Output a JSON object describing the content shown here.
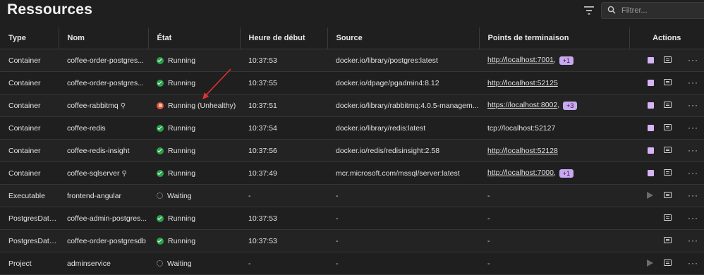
{
  "page": {
    "title": "Ressources"
  },
  "search": {
    "placeholder": "Filtrer..."
  },
  "columns": [
    "Type",
    "Nom",
    "État",
    "Heure de début",
    "Source",
    "Points de terminaison",
    "Actions"
  ],
  "rows": [
    {
      "type": "Container",
      "name": "coffee-order-postgres...",
      "pinned": false,
      "state": "Running",
      "state_kind": "ok",
      "start": "10:37:53",
      "source": "docker.io/library/postgres:latest",
      "endpoint": "http://localhost:7001",
      "endpoint_link": true,
      "endpoint_suffix": ",",
      "badge": "+1",
      "can_stop": true
    },
    {
      "type": "Container",
      "name": "coffee-order-postgres...",
      "pinned": false,
      "state": "Running",
      "state_kind": "ok",
      "start": "10:37:55",
      "source": "docker.io/dpage/pgadmin4:8.12",
      "endpoint": "http://localhost:52125",
      "endpoint_link": true,
      "endpoint_suffix": "",
      "badge": "",
      "can_stop": true
    },
    {
      "type": "Container",
      "name": "coffee-rabbitmq",
      "pinned": true,
      "state": "Running (Unhealthy)",
      "state_kind": "warn",
      "start": "10:37:51",
      "source": "docker.io/library/rabbitmq:4.0.5-managem...",
      "endpoint": "https://localhost:8002",
      "endpoint_link": true,
      "endpoint_suffix": ",",
      "badge": "+3",
      "can_stop": true
    },
    {
      "type": "Container",
      "name": "coffee-redis",
      "pinned": false,
      "state": "Running",
      "state_kind": "ok",
      "start": "10:37:54",
      "source": "docker.io/library/redis:latest",
      "endpoint": "tcp://localhost:52127",
      "endpoint_link": false,
      "endpoint_suffix": "",
      "badge": "",
      "can_stop": true
    },
    {
      "type": "Container",
      "name": "coffee-redis-insight",
      "pinned": false,
      "state": "Running",
      "state_kind": "ok",
      "start": "10:37:56",
      "source": "docker.io/redis/redisinsight:2.58",
      "endpoint": "http://localhost:52128",
      "endpoint_link": true,
      "endpoint_suffix": "",
      "badge": "",
      "can_stop": true
    },
    {
      "type": "Container",
      "name": "coffee-sqlserver",
      "pinned": true,
      "state": "Running",
      "state_kind": "ok",
      "start": "10:37:49",
      "source": "mcr.microsoft.com/mssql/server:latest",
      "endpoint": "http://localhost:7000",
      "endpoint_link": true,
      "endpoint_suffix": ",",
      "badge": "+1",
      "can_stop": true
    },
    {
      "type": "Executable",
      "name": "frontend-angular",
      "pinned": false,
      "state": "Waiting",
      "state_kind": "wait",
      "start": "-",
      "source": "-",
      "endpoint": "-",
      "endpoint_link": false,
      "endpoint_suffix": "",
      "badge": "",
      "can_stop": false,
      "can_start": true
    },
    {
      "type": "PostgresData...",
      "name": "coffee-admin-postgres...",
      "pinned": false,
      "state": "Running",
      "state_kind": "ok",
      "start": "10:37:53",
      "source": "-",
      "endpoint": "-",
      "endpoint_link": false,
      "endpoint_suffix": "",
      "badge": "",
      "can_stop": false
    },
    {
      "type": "PostgresData...",
      "name": "coffee-order-postgresdb",
      "pinned": false,
      "state": "Running",
      "state_kind": "ok",
      "start": "10:37:53",
      "source": "-",
      "endpoint": "-",
      "endpoint_link": false,
      "endpoint_suffix": "",
      "badge": "",
      "can_stop": false
    },
    {
      "type": "Project",
      "name": "adminservice",
      "pinned": false,
      "state": "Waiting",
      "state_kind": "wait",
      "start": "-",
      "source": "-",
      "endpoint": "-",
      "endpoint_link": false,
      "endpoint_suffix": "",
      "badge": "",
      "can_stop": false,
      "can_start": true
    }
  ],
  "icons": {
    "filter": "filter-icon",
    "search": "search-icon",
    "pin": "pin-icon",
    "stop": "stop-icon",
    "start": "play-icon",
    "logs": "console-logs-icon",
    "more": "more-icon"
  },
  "colors": {
    "running": "#2aa14a",
    "unhealthy": "#e0553a",
    "accent": "#c9a8f0",
    "annotation_arrow": "#e03131"
  }
}
